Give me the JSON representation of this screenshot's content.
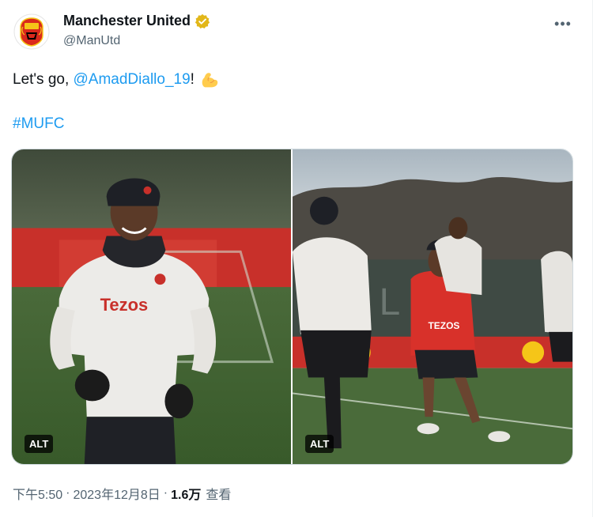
{
  "author": {
    "display_name": "Manchester United",
    "handle": "@ManUtd",
    "avatar_icon": "manchester-united-crest",
    "verified_icon": "gold-verified-badge-icon",
    "verified_color": "#e2b719"
  },
  "more_icon": "more-options-icon",
  "more_label": "•••",
  "tweet": {
    "text_prefix": "Let's go, ",
    "mention": "@AmadDiallo_19",
    "text_suffix": "!",
    "emoji": "flexed-biceps-emoji",
    "hashtag": "#MUFC"
  },
  "media": {
    "photos": [
      {
        "alt_label": "ALT",
        "description_icon": "player-smiling-photo"
      },
      {
        "alt_label": "ALT",
        "description_icon": "training-session-photo"
      }
    ],
    "left_shirt_text": "Tezos",
    "right_shirt_text": "TEZOS"
  },
  "meta": {
    "time": "下午5:50",
    "separator": "·",
    "date": "2023年12月8日",
    "views_count": "1.6万",
    "views_label": "查看"
  },
  "colors": {
    "link": "#1d9bf0",
    "secondary_text": "#536471",
    "primary_text": "#0f1419",
    "brand_red": "#da291c"
  }
}
